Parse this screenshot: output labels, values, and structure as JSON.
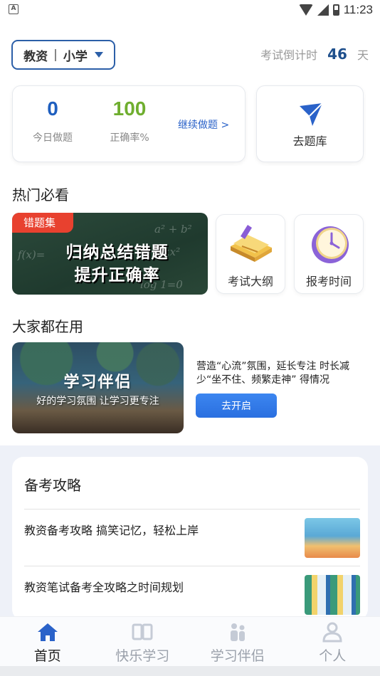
{
  "status_bar": {
    "time": "11:23",
    "left_badge": "A"
  },
  "header": {
    "exam_type": "教资",
    "divider": "|",
    "grade": "小学",
    "countdown_label": "考试倒计时",
    "countdown_days": "46",
    "countdown_unit": "天"
  },
  "stats": {
    "today_count": "0",
    "today_label": "今日做题",
    "accuracy": "100",
    "accuracy_label": "正确率%",
    "continue_label": "继续做题 >"
  },
  "question_bank": {
    "label": "去题库"
  },
  "hot": {
    "title": "热门必看",
    "banner": {
      "tag": "错题集",
      "line1": "归纳总结错题",
      "line2": "提升正确率"
    },
    "cards": [
      {
        "label": "考试大纲",
        "icon": "book-icon"
      },
      {
        "label": "报考时间",
        "icon": "clock-icon"
      }
    ]
  },
  "popular": {
    "title": "大家都在用",
    "banner_title": "学习伴侣",
    "banner_subtitle": "好的学习氛围 让学习更专注",
    "description": "营造“心流”氛围，延长专注 时长减少“坐不住、频繁走神” 得情况",
    "button_label": "去开启"
  },
  "guide": {
    "title": "备考攻略",
    "articles": [
      {
        "title": "教资备考攻略 搞笑记忆，轻松上岸"
      },
      {
        "title": "教资笔试备考全攻略之时间规划"
      }
    ]
  },
  "tabs": [
    {
      "label": "首页",
      "icon": "home-icon",
      "active": true
    },
    {
      "label": "快乐学习",
      "icon": "open-book-icon",
      "active": false
    },
    {
      "label": "学习伴侣",
      "icon": "people-icon",
      "active": false
    },
    {
      "label": "个人",
      "icon": "person-icon",
      "active": false
    }
  ],
  "colors": {
    "brand_blue": "#1f5fbf",
    "accuracy_green": "#6fae2f",
    "tag_red": "#e8412f",
    "tab_active": "#2a62c9"
  }
}
